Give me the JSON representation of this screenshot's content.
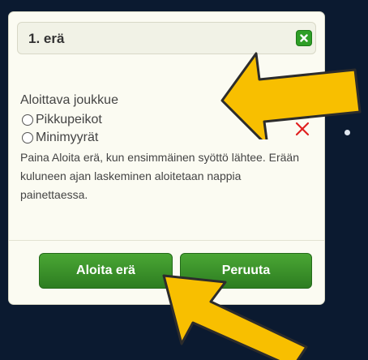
{
  "dialog": {
    "title": "1. erä",
    "close_icon": "close-x-icon",
    "starting_team_label": "Aloittava joukkue",
    "options": [
      "Pikkupeikot",
      "Minimyyrät"
    ],
    "instructions": "Paina Aloita erä, kun ensimmäinen syöttö lähtee. Erään kuluneen ajan laskeminen aloitetaan nappia painettaessa.",
    "start_button": "Aloita erä",
    "cancel_button": "Peruuta"
  },
  "annotations": {
    "arrow_color": "#f8bf00",
    "x_color": "#e02020",
    "arrow_icon": "arrow-icon",
    "x_icon": "red-x-icon"
  }
}
